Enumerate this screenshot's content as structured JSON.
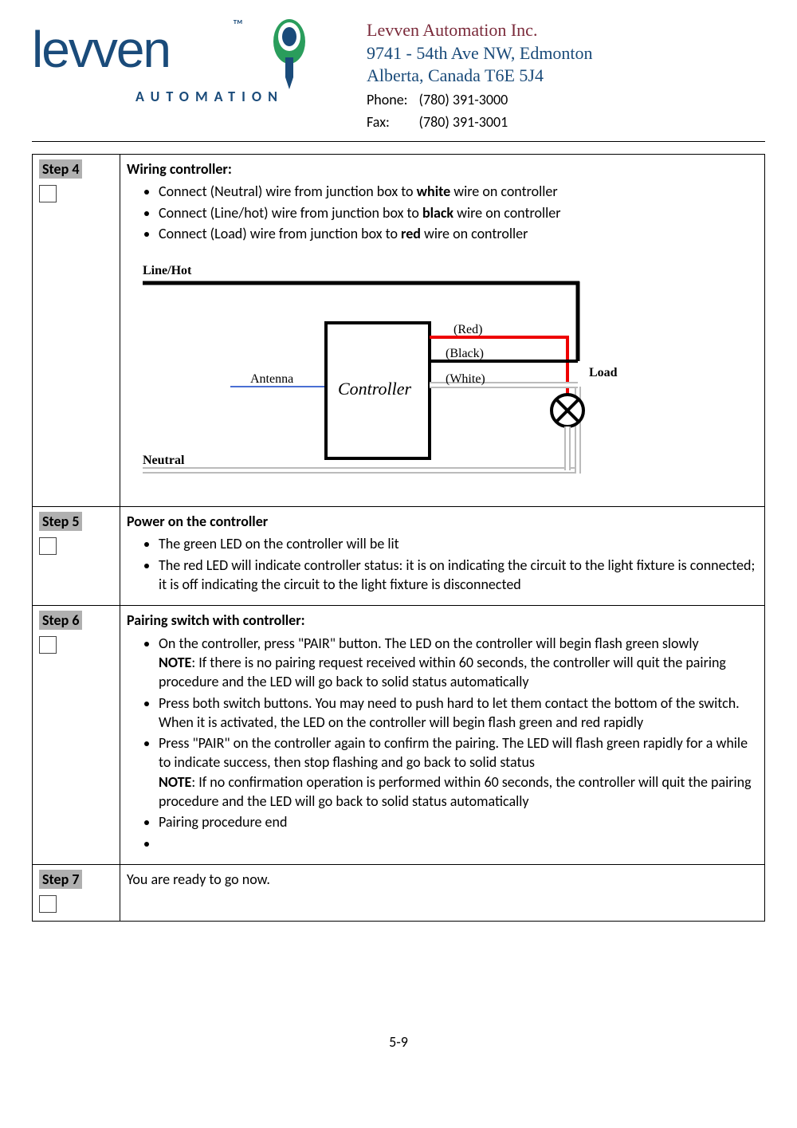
{
  "header": {
    "logo_text": "levven",
    "logo_tm": "™",
    "logo_sub": "AUTOMATION",
    "company_name": "Levven Automation Inc.",
    "addr1": "9741 - 54th Ave NW, Edmonton",
    "addr2": "Alberta, Canada T6E 5J4",
    "phone_label": "Phone:",
    "phone_val": "(780) 391-3000",
    "fax_label": "Fax:",
    "fax_val": "(780) 391-3001"
  },
  "steps": {
    "s4": {
      "label": "Step 4",
      "title": "Wiring controller:",
      "b1_a": "Connect (Neutral) wire from junction box to ",
      "b1_b": "white",
      "b1_c": " wire on controller",
      "b2_a": "Connect (Line/hot) wire from junction box to ",
      "b2_b": "black",
      "b2_c": " wire on controller",
      "b3_a": "Connect (Load) wire from junction box to ",
      "b3_b": "red",
      "b3_c": " wire on controller"
    },
    "s5": {
      "label": "Step 5",
      "title": "Power on the controller",
      "b1": "The green LED on the controller will be lit",
      "b2": "The red LED will indicate controller status: it is on indicating the circuit to the light fixture is connected;  it is off indicating the circuit to the light fixture is disconnected"
    },
    "s6": {
      "label": "Step 6",
      "title": "Pairing switch with controller:",
      "b1": "On the controller, press \"PAIR\" button. The LED on the controller will begin flash green slowly",
      "n1_a": "NOTE",
      "n1_b": ": If there is no pairing request received within 60 seconds, the controller will quit the pairing procedure and the LED will go back to solid status automatically",
      "b2": "Press both switch buttons. You may need to push hard to let them contact the bottom of the switch. When it is activated, the LED on the controller will begin flash green and red rapidly",
      "b3": "Press \"PAIR\" on the controller again to confirm the pairing. The LED will flash green rapidly for a while to indicate success,  then stop flashing and go back to solid status",
      "n2_a": "NOTE",
      "n2_b": ": If no confirmation operation is performed within 60 seconds, the controller will quit the pairing procedure and the LED will go back to solid status automatically",
      "b4": "Pairing procedure end"
    },
    "s7": {
      "label": "Step 7",
      "body": "You are ready to go now."
    }
  },
  "diagram": {
    "linehot": "Line/Hot",
    "neutral": "Neutral",
    "antenna": "Antenna",
    "controller": "Controller",
    "red": "(Red)",
    "black": "(Black)",
    "white": "(White)",
    "load": "Load"
  },
  "footer": {
    "page": "5-9"
  }
}
